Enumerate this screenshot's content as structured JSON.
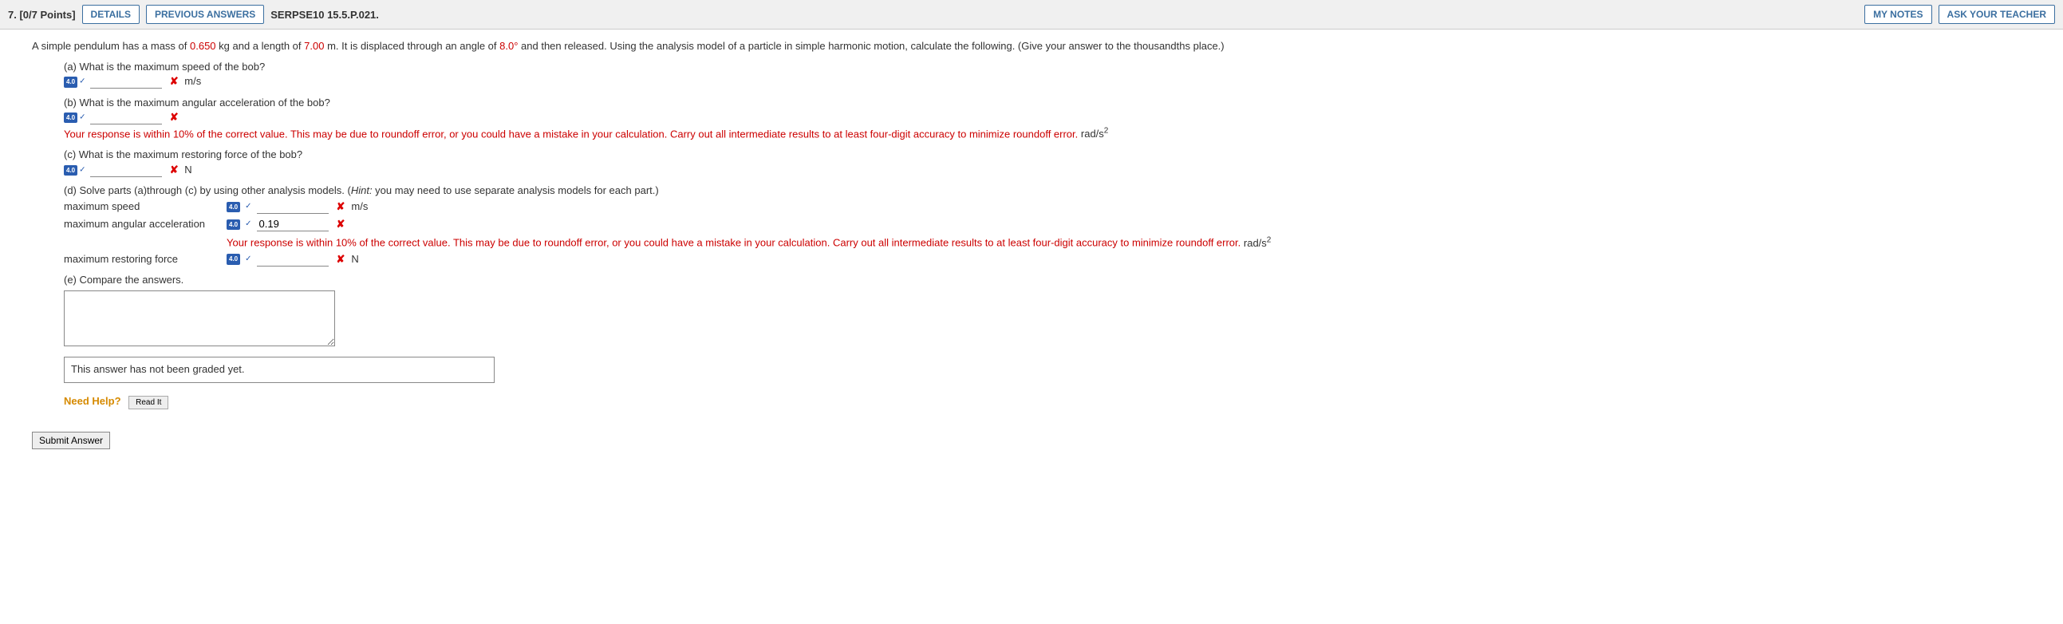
{
  "header": {
    "question_num": "7.",
    "points": "[0/7 Points]",
    "details": "DETAILS",
    "previous": "PREVIOUS ANSWERS",
    "ref": "SERPSE10 15.5.P.021.",
    "my_notes": "MY NOTES",
    "ask_teacher": "ASK YOUR TEACHER"
  },
  "problem": {
    "intro1": "A simple pendulum has a mass of ",
    "mass": "0.650",
    "intro2": " kg and a length of ",
    "length": "7.00",
    "intro3": " m. It is displaced through an angle of ",
    "angle": "8.0°",
    "intro4": " and then released. Using the analysis model of a particle in simple harmonic motion, calculate the following. (Give your answer to the thousandths place.)"
  },
  "parts": {
    "a": {
      "q": "(a) What is the maximum speed of the bob?",
      "badge": "4.0",
      "unit": "m/s"
    },
    "b": {
      "q": "(b) What is the maximum angular acceleration of the bob?",
      "badge": "4.0",
      "feedback": "Your response is within 10% of the correct value. This may be due to roundoff error, or you could have a mistake in your calculation. Carry out all intermediate results to at least four-digit accuracy to minimize roundoff error.",
      "unit_prefix": "rad/s",
      "unit_sup": "2"
    },
    "c": {
      "q": "(c) What is the maximum restoring force of the bob?",
      "badge": "4.0",
      "unit": "N"
    },
    "d": {
      "q1": "(d) Solve parts (a)through (c) by using other analysis models. (",
      "hint_label": "Hint:",
      "hint_text": " you may need to use separate analysis models for each part.)",
      "row1_label": "maximum speed",
      "row1_badge": "4.0",
      "row1_unit": "m/s",
      "row2_label": "maximum angular acceleration",
      "row2_badge": "4.0",
      "row2_value": "0.19",
      "row2_feedback": "Your response is within 10% of the correct value. This may be due to roundoff error, or you could have a mistake in your calculation. Carry out all intermediate results to at least four-digit accuracy to minimize roundoff error.",
      "row2_unit_prefix": "rad/s",
      "row2_unit_sup": "2",
      "row3_label": "maximum restoring force",
      "row3_badge": "4.0",
      "row3_unit": "N"
    },
    "e": {
      "q": "(e) Compare the answers.",
      "graded": "This answer has not been graded yet."
    }
  },
  "help": {
    "label": "Need Help?",
    "readit": "Read It"
  },
  "submit": "Submit Answer"
}
